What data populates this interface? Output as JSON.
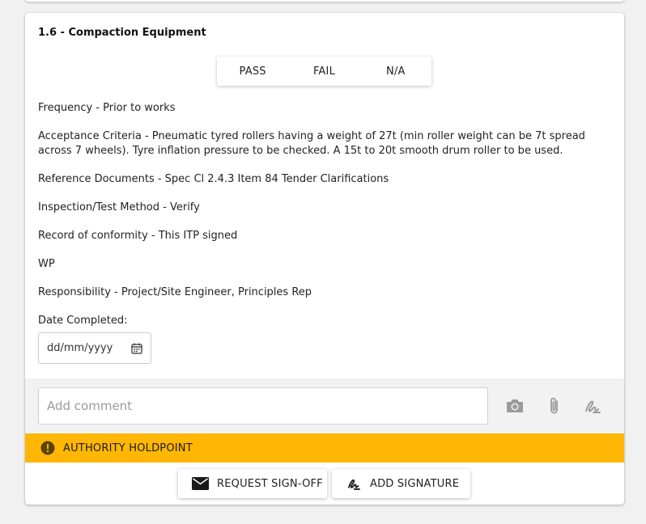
{
  "item": {
    "title": "1.6 - Compaction Equipment",
    "result_options": [
      "PASS",
      "FAIL",
      "N/A"
    ],
    "details": [
      "Frequency - Prior to works",
      "Acceptance Criteria - Pneumatic tyred rollers having a weight of 27t (min roller weight can be 7t spread across 7 wheels). Tyre inflation pressure to be checked. A 15t to 20t smooth drum roller to be used.",
      "Reference Documents - Spec Cl 2.4.3 Item 84 Tender Clarifications",
      "Inspection/Test Method - Verify",
      "Record of conformity - This ITP signed",
      "WP",
      "Responsibility - Project/Site Engineer, Principles Rep"
    ],
    "date_label": "Date Completed:",
    "date_placeholder": "dd/mm/yyyy"
  },
  "comment": {
    "placeholder": "Add comment",
    "icons": [
      "camera-icon",
      "paperclip-icon",
      "signature-icon"
    ]
  },
  "holdpoint": {
    "label": "AUTHORITY HOLDPOINT",
    "color": "#ffb703",
    "icon": "exclamation-circle-icon"
  },
  "actions": {
    "request_signoff": "REQUEST SIGN-OFF",
    "add_signature": "ADD SIGNATURE"
  }
}
